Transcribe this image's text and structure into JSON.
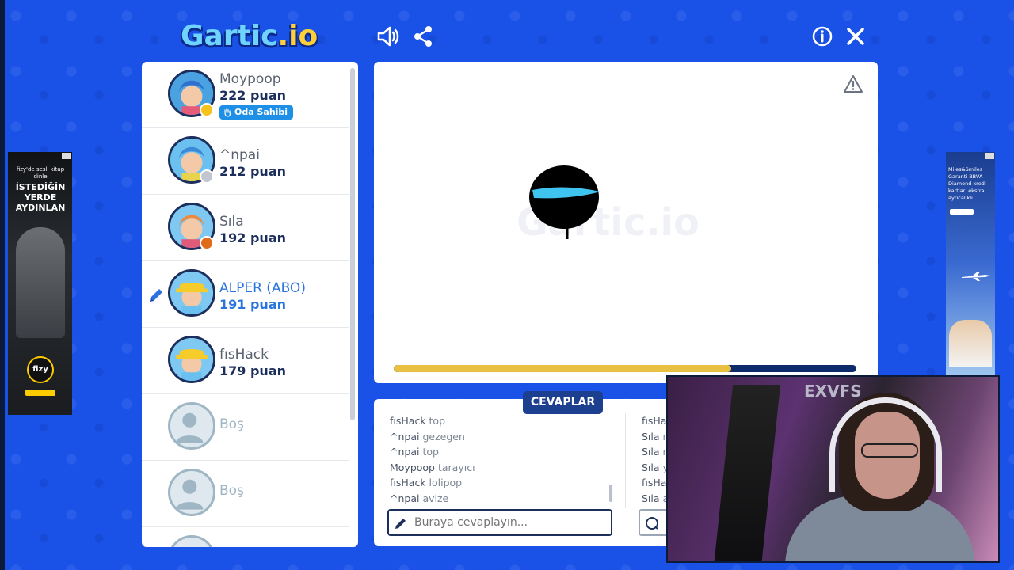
{
  "header": {
    "logo_main": "Gartic",
    "logo_io": ".io"
  },
  "players": [
    {
      "name": "Moypoop",
      "points": "222 puan",
      "badge": "Oda Sahibi",
      "status_color": "#f6c21c"
    },
    {
      "name": "^npai",
      "points": "212 puan",
      "status_color": "#c2c7cf"
    },
    {
      "name": "Sıla",
      "points": "192 puan",
      "status_color": "#e06b18"
    },
    {
      "name": "ALPER (ABO)",
      "points": "191 puan",
      "drawing": true
    },
    {
      "name": "fısHack",
      "points": "179 puan"
    },
    {
      "name": "Boş",
      "points": ""
    },
    {
      "name": "Boş",
      "points": ""
    }
  ],
  "canvas": {
    "watermark": "Gartic.io",
    "progress": 0.73
  },
  "answers": {
    "title": "CEVAPLAR",
    "left_lines": [
      {
        "user": "fısHack",
        "text": "top"
      },
      {
        "user": "^npai",
        "text": "gezegen"
      },
      {
        "user": "^npai",
        "text": "top"
      },
      {
        "user": "Moypoop",
        "text": "tarayıcı"
      },
      {
        "user": "fısHack",
        "text": "lolipop"
      },
      {
        "user": "^npai",
        "text": "avize"
      }
    ],
    "right_lines": [
      {
        "user": "fısHa",
        "text": ""
      },
      {
        "user": "Sıla",
        "text": "n"
      },
      {
        "user": "Sıla",
        "text": "n"
      },
      {
        "user": "Sıla",
        "text": "y"
      },
      {
        "user": "fısHa",
        "text": ""
      },
      {
        "user": "Sıla",
        "text": "a"
      }
    ],
    "input_placeholder": "Buraya cevaplayın..."
  },
  "ads": {
    "left": {
      "brand_line": "fizy'de sesli kitap dinle",
      "headline": "İSTEDİĞİN YERDE AYDINLAN",
      "logo": "fizy"
    },
    "right": {
      "text": "Miles&Smiles Garanti BBVA Diamond kredi kartları ekstra ayrıcalıklı"
    }
  },
  "webcam": {
    "wall_text": "EXVFS"
  },
  "colors": {
    "background": "#1a52e8",
    "navy": "#1c2e5c",
    "accent_blue": "#2b74e0",
    "progress_fill": "#e8c142"
  }
}
